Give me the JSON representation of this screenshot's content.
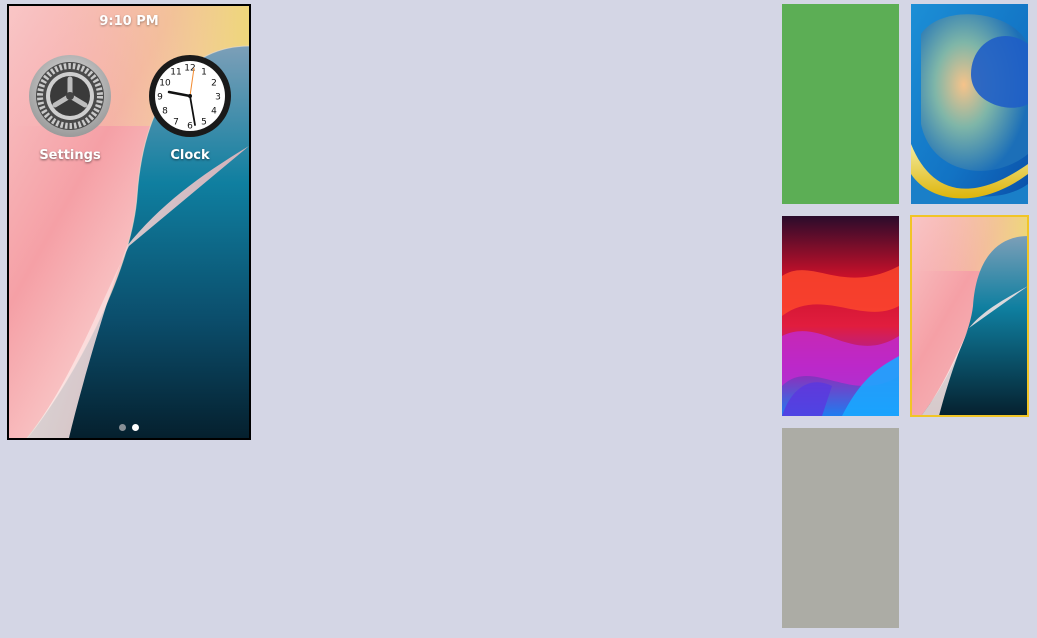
{
  "status_bar": {
    "time": "9:10 PM"
  },
  "home_screen": {
    "apps": [
      {
        "label": "Settings",
        "icon": "settings-gear-icon"
      },
      {
        "label": "Clock",
        "icon": "clock-icon"
      }
    ],
    "page_indicator": {
      "pages": 2,
      "current": 2
    }
  },
  "clock_face": {
    "numbers": [
      "12",
      "1",
      "2",
      "3",
      "4",
      "5",
      "6",
      "7",
      "8",
      "9",
      "10",
      "11"
    ]
  },
  "wallpaper_picker": {
    "items": [
      {
        "name": "solid-green",
        "color": "#5cae55",
        "selected": false
      },
      {
        "name": "blue-abstract",
        "selected": false
      },
      {
        "name": "red-purple-waves",
        "selected": false
      },
      {
        "name": "pastel-teal-waves",
        "selected": true
      },
      {
        "name": "solid-gray",
        "color": "#acaca5",
        "selected": false
      }
    ],
    "selection_color": "#f1c526"
  }
}
